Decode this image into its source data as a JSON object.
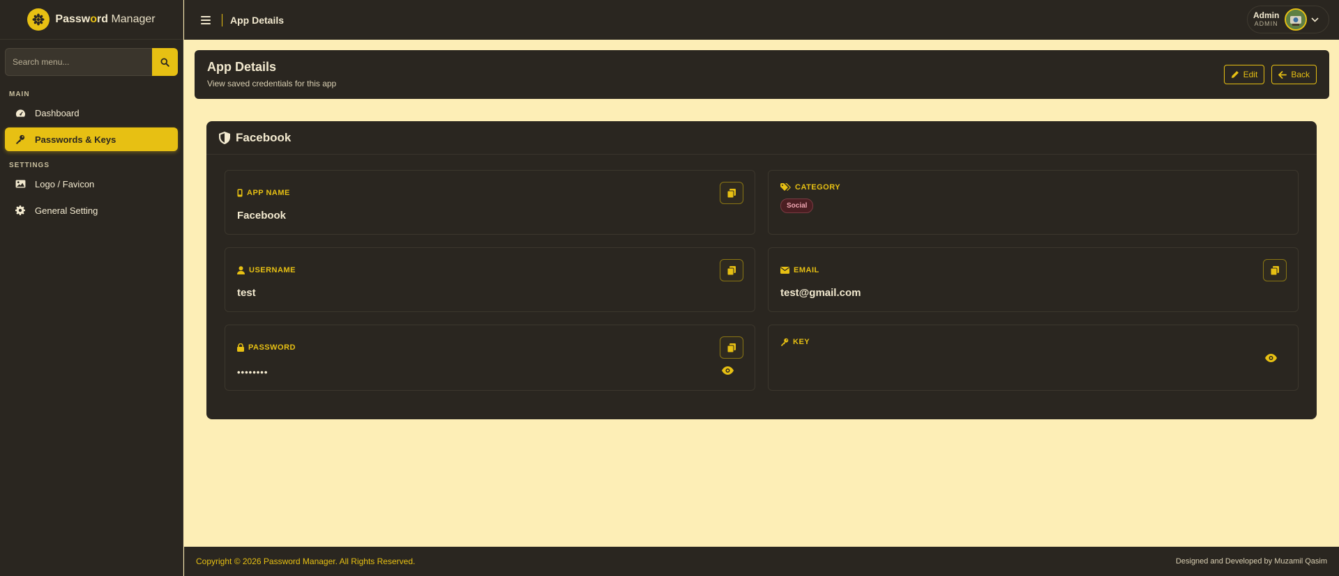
{
  "app": {
    "name_bold": "Passw",
    "name_o": "o",
    "name_rest": "rd",
    "name_thin": " Manager"
  },
  "sidebar": {
    "search_placeholder": "Search menu...",
    "section_main": "MAIN",
    "section_settings": "SETTINGS",
    "items": [
      {
        "label": "Dashboard",
        "icon": "gauge-icon"
      },
      {
        "label": "Passwords & Keys",
        "icon": "key-icon",
        "active": true
      },
      {
        "label": "Logo / Favicon",
        "icon": "image-icon"
      },
      {
        "label": "General Setting",
        "icon": "gear-icon"
      }
    ]
  },
  "topbar": {
    "title": "App Details",
    "user_name": "Admin",
    "user_role": "ADMIN"
  },
  "page": {
    "title": "App Details",
    "subtitle": "View saved credentials for this app",
    "edit_label": "Edit",
    "back_label": "Back"
  },
  "details": {
    "title": "Facebook",
    "app_name_label": "APP NAME",
    "app_name_value": "Facebook",
    "category_label": "CATEGORY",
    "category_value": "Social",
    "username_label": "USERNAME",
    "username_value": "test",
    "email_label": "EMAIL",
    "email_value": "test@gmail.com",
    "password_label": "PASSWORD",
    "password_value": "••••••••",
    "key_label": "KEY",
    "key_value": ""
  },
  "footer": {
    "copyright": "Copyright © 2026 Password Manager. All Rights Reserved.",
    "credit": "Designed and Developed by Muzamil Qasim"
  },
  "colors": {
    "accent": "#e7c013",
    "panel": "#2a2620",
    "page_bg": "#fdeeb6",
    "badge_bg": "#4a1e22"
  }
}
